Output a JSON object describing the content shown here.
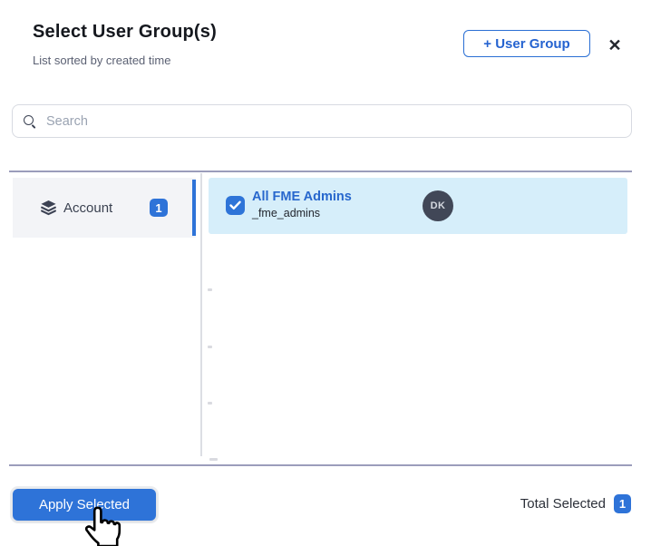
{
  "dialog": {
    "title": "Select User Group(s)",
    "subtitle": "List sorted by created time",
    "add_button_label": "+ User Group"
  },
  "icons": {
    "close": "✕",
    "search": "magnifier",
    "category": "layers-stack",
    "checkbox_check": "checkmark",
    "cursor": "hand-pointer"
  },
  "search": {
    "placeholder": "Search",
    "value": ""
  },
  "categories": [
    {
      "label": "Account",
      "count": "1",
      "active": true
    }
  ],
  "groups": [
    {
      "name": "All FME Admins",
      "id": "_fme_admins",
      "avatar_initials": "DK",
      "selected": true
    }
  ],
  "footer": {
    "apply_label": "Apply Selected",
    "total_label": "Total Selected",
    "total_count": "1"
  },
  "colors": {
    "primary_blue": "#2e73d8",
    "link_blue": "#2767cd",
    "selected_row_bg": "#d6eefa",
    "category_bg": "#f3f4f7",
    "avatar_bg": "#414757",
    "divider": "#9b9dbb"
  }
}
